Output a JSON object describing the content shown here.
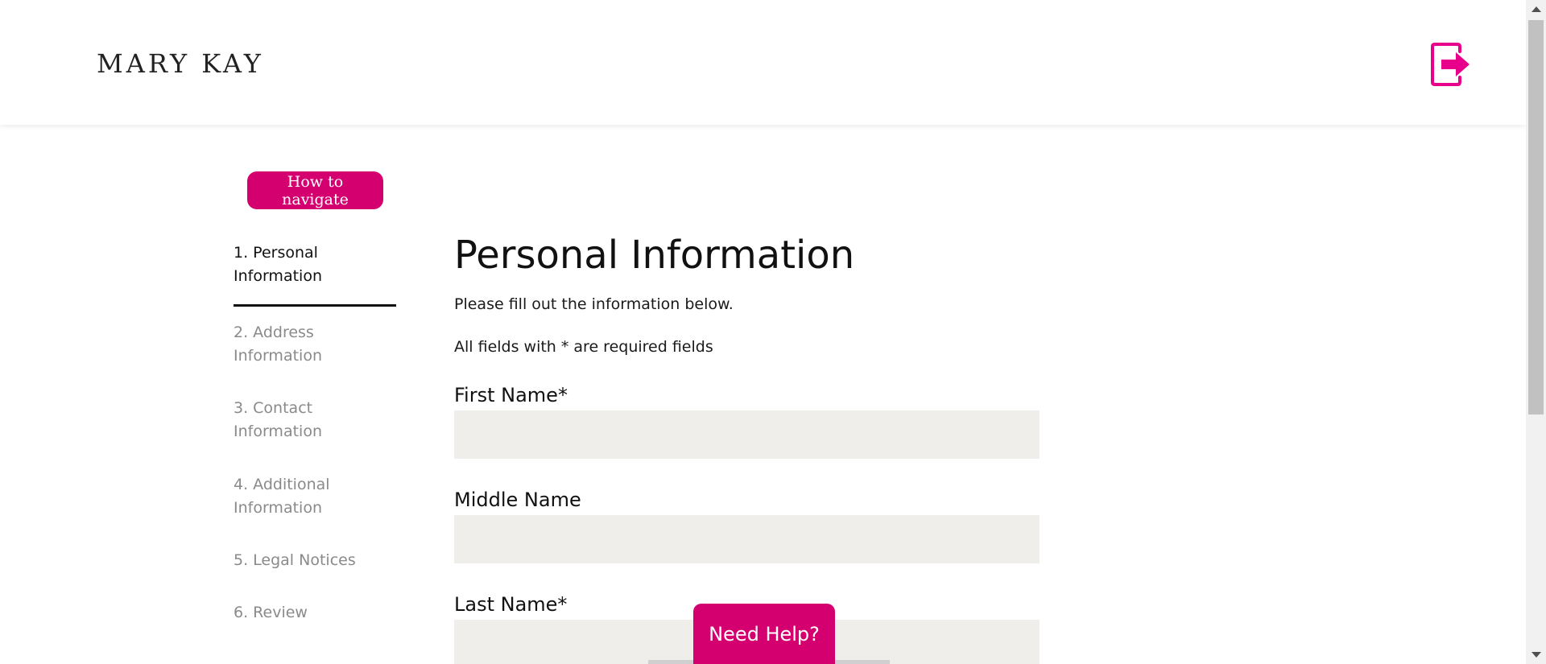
{
  "brand": {
    "logo_text": "MARY KAY",
    "accent_color": "#d5006f",
    "logout_icon_color": "#e8008a"
  },
  "header": {
    "logout_icon": "logout-icon"
  },
  "help_nav": {
    "label": "How to navigate"
  },
  "steps": [
    {
      "label": "1. Personal Information",
      "active": true
    },
    {
      "label": "2. Address Information",
      "active": false
    },
    {
      "label": "3. Contact Information",
      "active": false
    },
    {
      "label": "4. Additional Information",
      "active": false
    },
    {
      "label": "5. Legal Notices",
      "active": false
    },
    {
      "label": "6. Review",
      "active": false
    }
  ],
  "form": {
    "title": "Personal Information",
    "intro": "Please fill out the information below.",
    "required_note": "All fields with * are required fields",
    "fields": [
      {
        "label": "First Name*",
        "value": "",
        "placeholder": ""
      },
      {
        "label": "Middle Name",
        "value": "",
        "placeholder": ""
      },
      {
        "label": "Last Name*",
        "value": "",
        "placeholder": ""
      }
    ]
  },
  "need_help": {
    "label": "Need Help?"
  }
}
